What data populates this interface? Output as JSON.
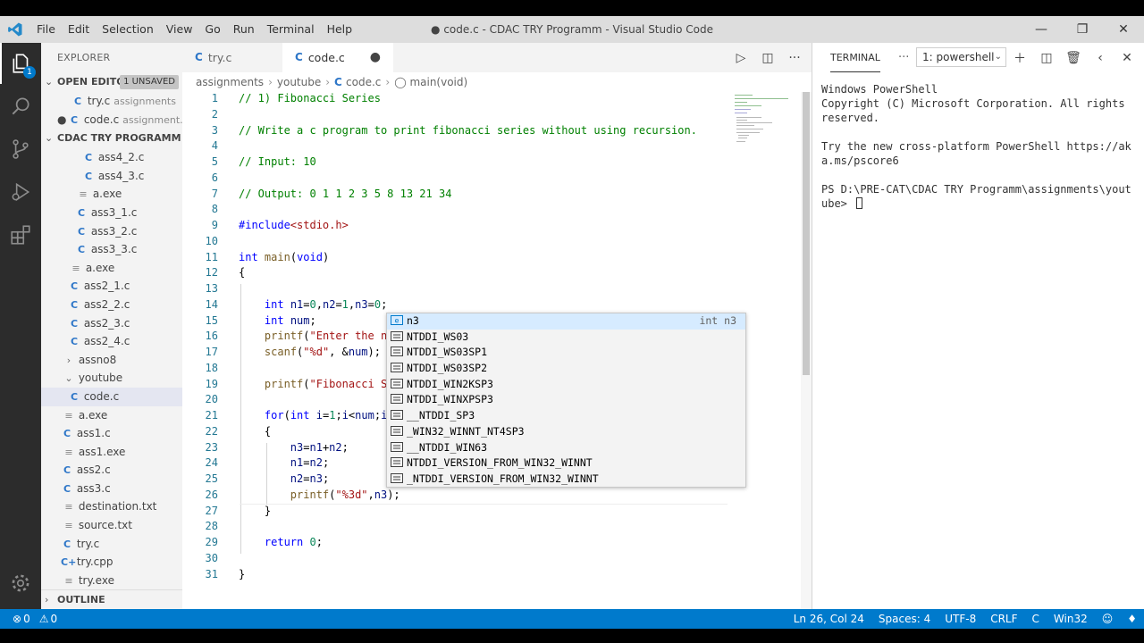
{
  "window": {
    "title": "● code.c - CDAC TRY Programm - Visual Studio Code",
    "menus": [
      "File",
      "Edit",
      "Selection",
      "View",
      "Go",
      "Run",
      "Terminal",
      "Help"
    ]
  },
  "sidebar": {
    "header": "EXPLORER",
    "open_editors": {
      "label": "OPEN EDITO...",
      "badge": "1 UNSAVED"
    },
    "open_files": [
      {
        "name": "try.c",
        "hint": "assignments"
      },
      {
        "name": "code.c",
        "hint": "assignment..."
      }
    ],
    "project": "CDAC TRY PROGRAMM",
    "tree": [
      {
        "name": "ass4_2.c",
        "kind": "c",
        "indent": 46
      },
      {
        "name": "ass4_3.c",
        "kind": "c",
        "indent": 46
      },
      {
        "name": "a.exe",
        "kind": "exe",
        "indent": 40
      },
      {
        "name": "ass3_1.c",
        "kind": "c",
        "indent": 38
      },
      {
        "name": "ass3_2.c",
        "kind": "c",
        "indent": 38
      },
      {
        "name": "ass3_3.c",
        "kind": "c",
        "indent": 38
      },
      {
        "name": "a.exe",
        "kind": "exe",
        "indent": 32
      },
      {
        "name": "ass2_1.c",
        "kind": "c",
        "indent": 30
      },
      {
        "name": "ass2_2.c",
        "kind": "c",
        "indent": 30
      },
      {
        "name": "ass2_3.c",
        "kind": "c",
        "indent": 30
      },
      {
        "name": "ass2_4.c",
        "kind": "c",
        "indent": 30
      },
      {
        "name": "assno8",
        "kind": "folder-closed",
        "indent": 24
      },
      {
        "name": "youtube",
        "kind": "folder-open",
        "indent": 24
      },
      {
        "name": "code.c",
        "kind": "c",
        "indent": 30,
        "selected": true
      },
      {
        "name": "a.exe",
        "kind": "exe",
        "indent": 24
      },
      {
        "name": "ass1.c",
        "kind": "c",
        "indent": 22
      },
      {
        "name": "ass1.exe",
        "kind": "exe",
        "indent": 24
      },
      {
        "name": "ass2.c",
        "kind": "c",
        "indent": 22
      },
      {
        "name": "ass3.c",
        "kind": "c",
        "indent": 22
      },
      {
        "name": "destination.txt",
        "kind": "txt",
        "indent": 24
      },
      {
        "name": "source.txt",
        "kind": "txt",
        "indent": 24
      },
      {
        "name": "try.c",
        "kind": "c",
        "indent": 22
      },
      {
        "name": "try.cpp",
        "kind": "cpp",
        "indent": 22
      },
      {
        "name": "try.exe",
        "kind": "exe",
        "indent": 24
      }
    ],
    "outline": "OUTLINE"
  },
  "editor": {
    "tabs": [
      {
        "name": "try.c",
        "active": false
      },
      {
        "name": "code.c",
        "active": true,
        "modified": true
      }
    ],
    "breadcrumbs": [
      "assignments",
      "youtube",
      "code.c",
      "main(void)"
    ],
    "lines": [
      {
        "n": "1",
        "html": "<span class=\"cm\">// 1) Fibonacci Series</span>"
      },
      {
        "n": "2",
        "html": ""
      },
      {
        "n": "3",
        "html": "<span class=\"cm\">// Write a c program to print fibonacci series without using recursion.</span>"
      },
      {
        "n": "4",
        "html": ""
      },
      {
        "n": "5",
        "html": "<span class=\"cm\">// Input: 10</span>"
      },
      {
        "n": "6",
        "html": ""
      },
      {
        "n": "7",
        "html": "<span class=\"cm\">// Output: 0 1 1 2 3 5 8 13 21 34</span>"
      },
      {
        "n": "8",
        "html": ""
      },
      {
        "n": "9",
        "html": "<span class=\"pp\">#include</span><span class=\"st\">&lt;stdio.h&gt;</span>"
      },
      {
        "n": "10",
        "html": ""
      },
      {
        "n": "11",
        "html": "<span class=\"kw\">int</span> <span class=\"fn\">main</span>(<span class=\"kw\">void</span>)"
      },
      {
        "n": "12",
        "html": "{"
      },
      {
        "n": "13",
        "html": ""
      },
      {
        "n": "14",
        "html": "    <span class=\"kw\">int</span> <span class=\"vr\">n1</span>=<span class=\"nm\">0</span>,<span class=\"vr\">n2</span>=<span class=\"nm\">1</span>,<span class=\"vr\">n3</span>=<span class=\"nm\">0</span>;"
      },
      {
        "n": "15",
        "html": "    <span class=\"kw\">int</span> <span class=\"vr\">num</span>;"
      },
      {
        "n": "16",
        "html": "    <span class=\"fn\">printf</span>(<span class=\"st\">\"Enter the n</span>"
      },
      {
        "n": "17",
        "html": "    <span class=\"fn\">scanf</span>(<span class=\"st\">\"%d\"</span>, &amp;<span class=\"vr\">num</span>);"
      },
      {
        "n": "18",
        "html": ""
      },
      {
        "n": "19",
        "html": "    <span class=\"fn\">printf</span>(<span class=\"st\">\"Fibonacci S</span>"
      },
      {
        "n": "20",
        "html": ""
      },
      {
        "n": "21",
        "html": "    <span class=\"kw\">for</span>(<span class=\"kw\">int</span> <span class=\"vr\">i</span>=<span class=\"nm\">1</span>;<span class=\"vr\">i</span>&lt;<span class=\"vr\">num</span>;<span class=\"vr\">i</span>"
      },
      {
        "n": "22",
        "html": "    {"
      },
      {
        "n": "23",
        "html": "        <span class=\"vr\">n3</span>=<span class=\"vr\">n1</span>+<span class=\"vr\">n2</span>;"
      },
      {
        "n": "24",
        "html": "        <span class=\"vr\">n1</span>=<span class=\"vr\">n2</span>;"
      },
      {
        "n": "25",
        "html": "        <span class=\"vr\">n2</span>=<span class=\"vr\">n3</span>;"
      },
      {
        "n": "26",
        "html": "        <span class=\"fn\">printf</span>(<span class=\"st\">\"%3d\"</span>,<span class=\"vr\">n3</span>);"
      },
      {
        "n": "27",
        "html": "    }"
      },
      {
        "n": "28",
        "html": ""
      },
      {
        "n": "29",
        "html": "    <span class=\"kw\">return</span> <span class=\"nm\">0</span>;"
      },
      {
        "n": "30",
        "html": ""
      },
      {
        "n": "31",
        "html": "}"
      }
    ],
    "suggestions": [
      {
        "label": "n3",
        "kind": "variable",
        "detail": "int n3",
        "selected": true
      },
      {
        "label": "NTDDI_WS03",
        "kind": "constant"
      },
      {
        "label": "NTDDI_WS03SP1",
        "kind": "constant"
      },
      {
        "label": "NTDDI_WS03SP2",
        "kind": "constant"
      },
      {
        "label": "NTDDI_WIN2KSP3",
        "kind": "constant"
      },
      {
        "label": "NTDDI_WINXPSP3",
        "kind": "constant"
      },
      {
        "label": "__NTDDI_SP3",
        "kind": "constant"
      },
      {
        "label": "_WIN32_WINNT_NT4SP3",
        "kind": "constant"
      },
      {
        "label": "__NTDDI_WIN63",
        "kind": "constant"
      },
      {
        "label": "NTDDI_VERSION_FROM_WIN32_WINNT",
        "kind": "constant"
      },
      {
        "label": "_NTDDI_VERSION_FROM_WIN32_WINNT",
        "kind": "constant"
      }
    ]
  },
  "panel": {
    "tab": "TERMINAL",
    "selector": "1: powershell",
    "terminal_lines": [
      "Windows PowerShell",
      "Copyright (C) Microsoft Corporation. All rights reserved.",
      "",
      "Try the new cross-platform PowerShell https://aka.ms/pscore6",
      "",
      "PS D:\\PRE-CAT\\CDAC TRY Programm\\assignments\\youtube> "
    ]
  },
  "statusbar": {
    "errors": "0",
    "warnings": "0",
    "position": "Ln 26, Col 24",
    "spaces": "Spaces: 4",
    "encoding": "UTF-8",
    "eol": "CRLF",
    "language": "C",
    "config": "Win32"
  },
  "colors": {
    "accent": "#007acc",
    "activitybar": "#2c2c2c",
    "sidebar": "#f3f3f3"
  }
}
